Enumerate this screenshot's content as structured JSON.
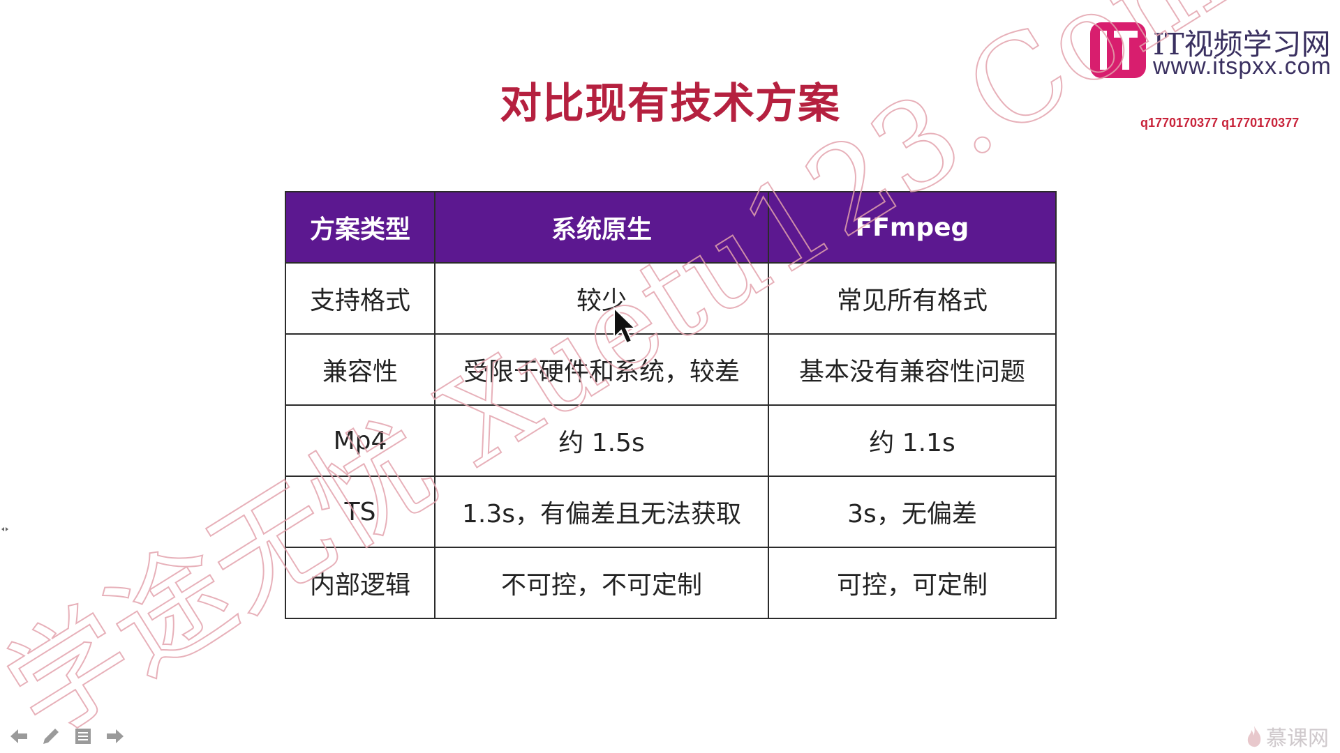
{
  "slide": {
    "title": "对比现有技术方案"
  },
  "logo": {
    "mark_text": "IT",
    "name": "IT视频学习网",
    "url": "www.itspxx.com"
  },
  "qq_text": "q1770170377 q1770170377",
  "watermark_text": "学途无忧 Xuetu123.Com",
  "table": {
    "headers": [
      "方案类型",
      "系统原生",
      "FFmpeg"
    ],
    "rows": [
      [
        "支持格式",
        "较少",
        "常见所有格式"
      ],
      [
        "兼容性",
        "受限于硬件和系统，较差",
        "基本没有兼容性问题"
      ],
      [
        "Mp4",
        "约 1.5s",
        "约 1.1s"
      ],
      [
        "TS",
        "1.3s，有偏差且无法获取",
        "3s，无偏差"
      ],
      [
        "内部逻辑",
        "不可控，不可定制",
        "可控，可定制"
      ]
    ]
  },
  "toolbar": {
    "buttons": [
      "arrow-left-icon",
      "pen-icon",
      "menu-icon",
      "arrow-right-icon"
    ]
  },
  "brand": {
    "text": "慕课网"
  },
  "colors": {
    "title": "#b5203f",
    "header_bg": "#5c1890",
    "logo_mark": "#d81e6e",
    "watermark": "#e3a3ad"
  }
}
